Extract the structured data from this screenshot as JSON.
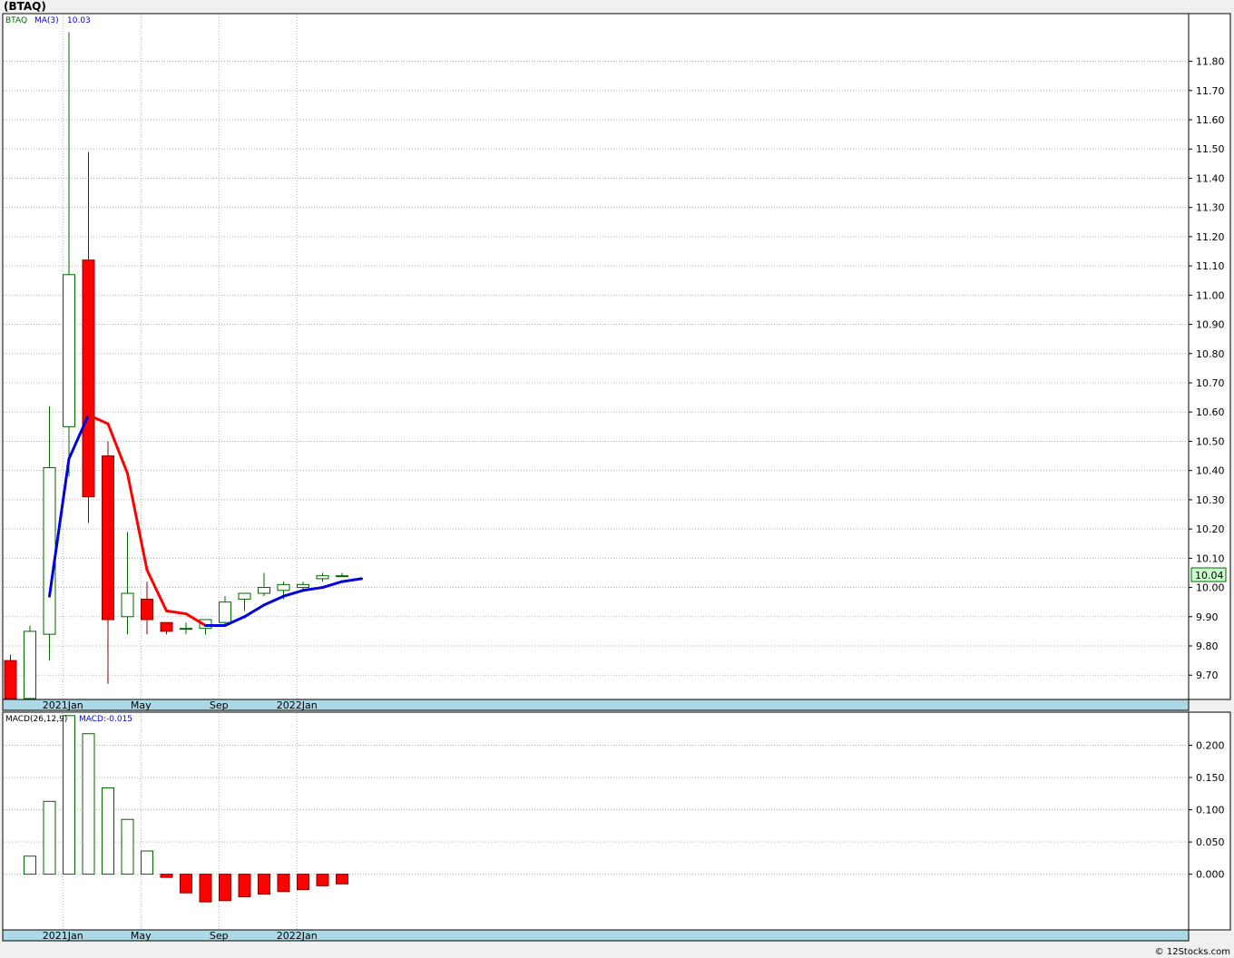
{
  "symbol_title": "(BTAQ)",
  "watermark": "© 12Stocks.com",
  "colors": {
    "up_body": "#ffffff",
    "up_stroke": "#006400",
    "down_body": "#ff0000",
    "down_stroke": "#8b0000",
    "ma_up": "#0000dd",
    "ma_down": "#ff0000",
    "grid": "#b0b0b0",
    "axis_band": "#add8e6",
    "last_price_bg": "#ccffcc"
  },
  "chart_data": [
    {
      "type": "candlestick",
      "label_symbol": "BTAQ",
      "label_ma": "MA(3)",
      "label_ma_value": "10.03",
      "last_price_label": "10.04",
      "ylim": [
        9.62,
        11.96
      ],
      "y_ticks": [
        "9.70",
        "9.80",
        "9.90",
        "10.00",
        "10.10",
        "10.20",
        "10.30",
        "10.40",
        "10.50",
        "10.60",
        "10.70",
        "10.80",
        "10.90",
        "11.00",
        "11.10",
        "11.20",
        "11.30",
        "11.40",
        "11.50",
        "11.60",
        "11.70",
        "11.80"
      ],
      "x_labels": [
        {
          "label": "2021Jan",
          "index": 3
        },
        {
          "label": "May",
          "index": 7
        },
        {
          "label": "Sep",
          "index": 11
        },
        {
          "label": "2022Jan",
          "index": 15
        }
      ],
      "grid_indices": [
        3,
        7,
        11,
        15
      ],
      "candles": [
        {
          "o": 9.75,
          "h": 9.77,
          "l": 9.62,
          "c": 9.62
        },
        {
          "o": 9.62,
          "h": 9.87,
          "l": 9.62,
          "c": 9.85
        },
        {
          "o": 9.84,
          "h": 10.62,
          "l": 9.75,
          "c": 10.41
        },
        {
          "o": 10.55,
          "h": 11.9,
          "l": 10.38,
          "c": 11.07
        },
        {
          "o": 11.12,
          "h": 11.49,
          "l": 10.22,
          "c": 10.31
        },
        {
          "o": 10.45,
          "h": 10.5,
          "l": 9.67,
          "c": 9.89
        },
        {
          "o": 9.9,
          "h": 10.19,
          "l": 9.84,
          "c": 9.98
        },
        {
          "o": 9.96,
          "h": 10.02,
          "l": 9.84,
          "c": 9.89
        },
        {
          "o": 9.88,
          "h": 9.88,
          "l": 9.84,
          "c": 9.85
        },
        {
          "o": 9.86,
          "h": 9.88,
          "l": 9.84,
          "c": 9.86
        },
        {
          "o": 9.86,
          "h": 9.89,
          "l": 9.84,
          "c": 9.89
        },
        {
          "o": 9.88,
          "h": 9.97,
          "l": 9.87,
          "c": 9.95
        },
        {
          "o": 9.96,
          "h": 9.98,
          "l": 9.92,
          "c": 9.98
        },
        {
          "o": 9.98,
          "h": 10.05,
          "l": 9.97,
          "c": 10.0
        },
        {
          "o": 9.99,
          "h": 10.02,
          "l": 9.96,
          "c": 10.01
        },
        {
          "o": 10.0,
          "h": 10.02,
          "l": 9.99,
          "c": 10.01
        },
        {
          "o": 10.03,
          "h": 10.05,
          "l": 10.02,
          "c": 10.04
        },
        {
          "o": 10.04,
          "h": 10.05,
          "l": 10.04,
          "c": 10.04
        }
      ],
      "ma": [
        null,
        null,
        9.97,
        10.44,
        10.59,
        10.56,
        10.39,
        10.06,
        9.92,
        9.91,
        9.87,
        9.87,
        9.9,
        9.94,
        9.97,
        9.99,
        10.0,
        10.02,
        10.03
      ]
    },
    {
      "type": "bar",
      "label_macd": "MACD(26,12,9)",
      "label_macd_value": "MACD:-0.015",
      "ylim": [
        -0.085,
        0.25
      ],
      "y_ticks": [
        "0.000",
        "0.050",
        "0.100",
        "0.150",
        "0.200"
      ],
      "x_labels": [
        {
          "label": "2021Jan",
          "index": 3
        },
        {
          "label": "May",
          "index": 7
        },
        {
          "label": "Sep",
          "index": 11
        },
        {
          "label": "2022Jan",
          "index": 15
        }
      ],
      "values": [
        null,
        0.028,
        0.113,
        0.246,
        0.218,
        0.134,
        0.085,
        0.036,
        -0.005,
        -0.029,
        -0.043,
        -0.041,
        -0.035,
        -0.031,
        -0.027,
        -0.024,
        -0.018,
        -0.015
      ]
    }
  ]
}
